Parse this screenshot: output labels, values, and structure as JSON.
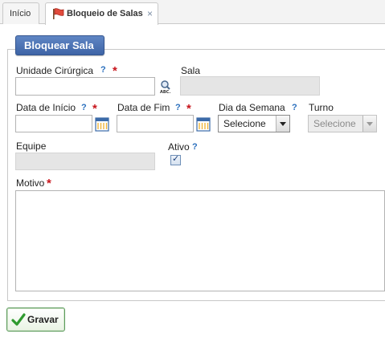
{
  "tabs": [
    {
      "label": "Início"
    },
    {
      "label": "Bloqueio de Salas",
      "close": "×"
    }
  ],
  "form": {
    "legend": "Bloquear Sala",
    "unidade_label": "Unidade Cirúrgica",
    "sala_label": "Sala",
    "data_inicio_label": "Data de Início",
    "data_fim_label": "Data de Fim",
    "dia_semana_label": "Dia da Semana",
    "turno_label": "Turno",
    "equipe_label": "Equipe",
    "ativo_label": "Ativo",
    "motivo_label": "Motivo",
    "dia_semana_value": "Selecione",
    "turno_value": "Selecione",
    "help": "?",
    "required": "*",
    "ativo_checked": true
  },
  "actions": {
    "gravar_label": "Gravar"
  },
  "colors": {
    "legend_bg": "#4a70b3",
    "help": "#2a6fbd",
    "required": "#c8161d",
    "save_border": "#5b9b5b"
  }
}
